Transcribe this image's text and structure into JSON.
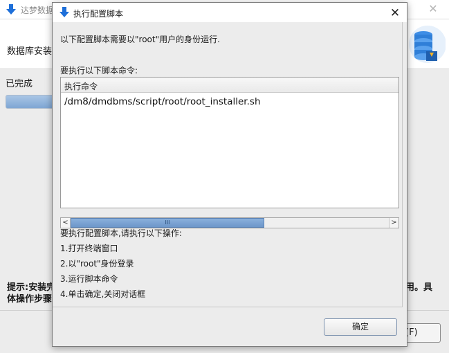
{
  "background_window": {
    "title": "达梦数据",
    "step_title": "数据库安装",
    "status": "已完成",
    "hint_line1": "提示:安装完",
    "hint_line2": "体操作步骤",
    "hint_right": "用。具",
    "button_label": "(F)",
    "icons": {
      "title_icon": "download-arrow-icon",
      "logo": "database-server-logo",
      "close": "close-icon"
    }
  },
  "dialog": {
    "title": "执行配置脚本",
    "close_icon": "close-icon",
    "title_icon": "download-arrow-icon",
    "message": "以下配置脚本需要以\"root\"用户的身份运行.",
    "command_label": "要执行以下脚本命令:",
    "table": {
      "header": "执行命令",
      "rows": [
        "/dm8/dmdbms/script/root/root_installer.sh"
      ]
    },
    "scrollbar": {
      "left_arrow": "<",
      "right_arrow": ">",
      "thumb_grip": "III"
    },
    "instructions_title": "要执行配置脚本,请执行以下操作:",
    "steps": [
      "1.打开终端窗口",
      "2.以\"root\"身份登录",
      "3.运行脚本命令",
      "4.单击确定,关闭对话框"
    ],
    "ok_button": "确定"
  },
  "colors": {
    "accent_blue": "#1e6fd9",
    "progress_fill": "#7fa6d3",
    "scroll_thumb": "#6d97ca"
  }
}
